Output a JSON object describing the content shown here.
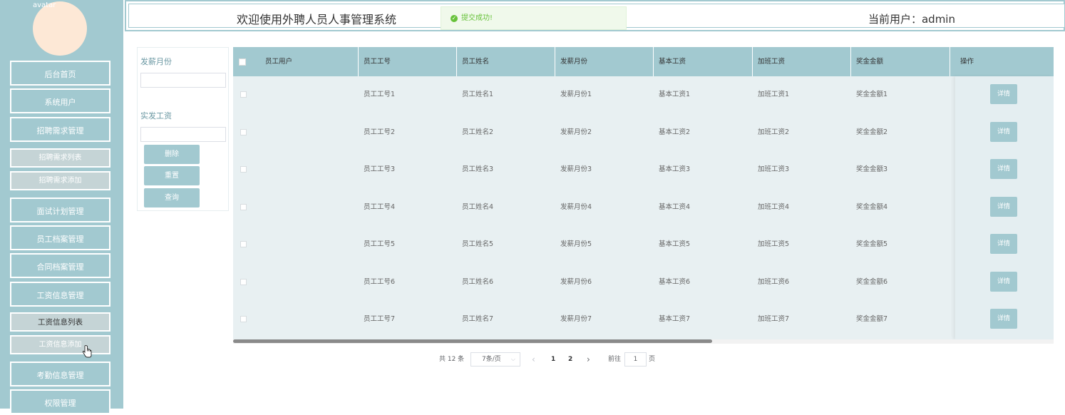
{
  "sidebar": {
    "avatar_alt": "avatar",
    "items": [
      {
        "label": "后台首页",
        "type": "main"
      },
      {
        "label": "系统用户",
        "type": "main"
      },
      {
        "label": "招聘需求管理",
        "type": "main"
      },
      {
        "label": "招聘需求列表",
        "type": "sub"
      },
      {
        "label": "招聘需求添加",
        "type": "sub"
      },
      {
        "label": "面试计划管理",
        "type": "main"
      },
      {
        "label": "员工档案管理",
        "type": "main"
      },
      {
        "label": "合同档案管理",
        "type": "main"
      },
      {
        "label": "工资信息管理",
        "type": "main"
      },
      {
        "label": "工资信息列表",
        "type": "sub",
        "active": true
      },
      {
        "label": "工资信息添加",
        "type": "sub"
      },
      {
        "label": "考勤信息管理",
        "type": "main"
      },
      {
        "label": "权限管理",
        "type": "main"
      }
    ]
  },
  "header": {
    "title": "欢迎使用外聘人员人事管理系统",
    "user_text": "当前用户：admin"
  },
  "toast": {
    "message": "提交成功!",
    "icon": "check-circle-icon",
    "color": "#67c23a"
  },
  "search": {
    "field1_label": "发薪月份",
    "field1_value": "",
    "field2_label": "实发工资",
    "field2_value": "",
    "delete_label": "删除",
    "reset_label": "重置",
    "query_label": "查询"
  },
  "table": {
    "columns": [
      "员工用户",
      "员工工号",
      "员工姓名",
      "发薪月份",
      "基本工资",
      "加班工资",
      "奖金金额",
      "操作"
    ],
    "rows": [
      {
        "user": "",
        "id": "员工工号1",
        "name": "员工姓名1",
        "month": "发薪月份1",
        "base": "基本工资1",
        "overtime": "加班工资1",
        "bonus": "奖金金额1",
        "action": "详情"
      },
      {
        "user": "",
        "id": "员工工号2",
        "name": "员工姓名2",
        "month": "发薪月份2",
        "base": "基本工资2",
        "overtime": "加班工资2",
        "bonus": "奖金金额2",
        "action": "详情"
      },
      {
        "user": "",
        "id": "员工工号3",
        "name": "员工姓名3",
        "month": "发薪月份3",
        "base": "基本工资3",
        "overtime": "加班工资3",
        "bonus": "奖金金额3",
        "action": "详情"
      },
      {
        "user": "",
        "id": "员工工号4",
        "name": "员工姓名4",
        "month": "发薪月份4",
        "base": "基本工资4",
        "overtime": "加班工资4",
        "bonus": "奖金金额4",
        "action": "详情"
      },
      {
        "user": "",
        "id": "员工工号5",
        "name": "员工姓名5",
        "month": "发薪月份5",
        "base": "基本工资5",
        "overtime": "加班工资5",
        "bonus": "奖金金额5",
        "action": "详情"
      },
      {
        "user": "",
        "id": "员工工号6",
        "name": "员工姓名6",
        "month": "发薪月份6",
        "base": "基本工资6",
        "overtime": "加班工资6",
        "bonus": "奖金金额6",
        "action": "详情"
      },
      {
        "user": "",
        "id": "员工工号7",
        "name": "员工姓名7",
        "month": "发薪月份7",
        "base": "基本工资7",
        "overtime": "加班工资7",
        "bonus": "奖金金额7",
        "action": "详情"
      }
    ]
  },
  "pagination": {
    "total": "共 12 条",
    "page_size": "7条/页",
    "prev": "‹",
    "pages": [
      "1",
      "2"
    ],
    "next": "›",
    "goto_label": "前往",
    "goto_value": "1",
    "goto_suffix": "页"
  },
  "colors": {
    "accent": "#a2c9d0",
    "table_bg": "#e8f0f2"
  }
}
